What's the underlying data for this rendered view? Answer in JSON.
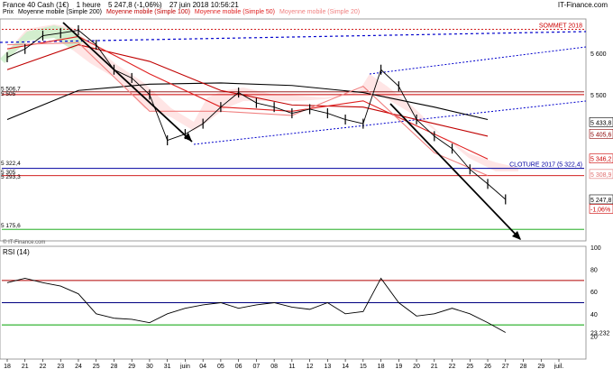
{
  "header": {
    "instrument": "France 40 Cash (1€)",
    "timeframe": "1 heure",
    "quote": "5 247,8 (-1,06%)",
    "datetime": "27 juin 2018 10:56:21",
    "brand": "IT-Finance.com",
    "copyright": "© IT-Finance.com"
  },
  "legend": [
    {
      "label": "Prix",
      "color": "#000000"
    },
    {
      "label": "Moyenne mobile (Simple 200)",
      "color": "#000000"
    },
    {
      "label": "Moyenne mobile (Simple 100)",
      "color": "#c00000"
    },
    {
      "label": "Moyenne mobile (Simple 50)",
      "color": "#e02020"
    },
    {
      "label": "Moyenne mobile (Simple 20)",
      "color": "#f08080"
    }
  ],
  "chart_data": [
    {
      "type": "line",
      "ylim": [
        5150,
        5680
      ],
      "x_ticks": [
        "18",
        "21",
        "22",
        "23",
        "24",
        "25",
        "28",
        "29",
        "30",
        "31",
        "juin",
        "04",
        "05",
        "06",
        "07",
        "08",
        "11",
        "12",
        "13",
        "14",
        "15",
        "18",
        "19",
        "20",
        "21",
        "22",
        "25",
        "26",
        "27",
        "28",
        "29",
        "juil."
      ],
      "y_ticks": [
        5600,
        5500,
        5433.8,
        5405.6,
        5346.2,
        5308.9
      ],
      "series": [
        {
          "name": "Prix",
          "color": "#000000",
          "x": [
            0,
            1,
            2,
            3,
            4,
            5,
            6,
            7,
            8,
            9,
            10,
            11,
            12,
            13,
            14,
            15,
            16,
            17,
            18,
            19,
            20,
            21,
            22,
            23,
            24,
            25,
            26,
            27,
            28
          ],
          "values": [
            5590,
            5610,
            5642,
            5648,
            5655,
            5620,
            5560,
            5540,
            5500,
            5390,
            5405,
            5430,
            5470,
            5505,
            5480,
            5470,
            5455,
            5465,
            5455,
            5440,
            5430,
            5560,
            5520,
            5440,
            5400,
            5370,
            5320,
            5285,
            5247.8
          ]
        },
        {
          "name": "Moyenne mobile (Simple 200)",
          "color": "#000000",
          "x": [
            0,
            4,
            8,
            12,
            16,
            20,
            24,
            27
          ],
          "values": [
            5440,
            5510,
            5525,
            5528,
            5522,
            5505,
            5470,
            5440
          ]
        },
        {
          "name": "Moyenne mobile (Simple 100)",
          "color": "#c00000",
          "x": [
            0,
            4,
            8,
            12,
            16,
            20,
            24,
            27
          ],
          "values": [
            5560,
            5620,
            5580,
            5510,
            5475,
            5470,
            5430,
            5400
          ]
        },
        {
          "name": "Moyenne mobile (Simple 50)",
          "color": "#e02020",
          "x": [
            0,
            4,
            8,
            12,
            16,
            20,
            24,
            27
          ],
          "values": [
            5610,
            5640,
            5550,
            5470,
            5460,
            5485,
            5405,
            5345
          ]
        },
        {
          "name": "Moyenne mobile (Simple 20)",
          "color": "#f08080",
          "x": [
            0,
            4,
            8,
            12,
            16,
            20,
            24,
            27
          ],
          "values": [
            5620,
            5625,
            5460,
            5460,
            5450,
            5520,
            5360,
            5305
          ]
        }
      ],
      "annotations": [
        {
          "label": "SOMMET 2018",
          "value": 5657,
          "color": "#cc0000",
          "style": "dotted"
        },
        {
          "label": "CLOTURE 2017 (5 322,4)",
          "value": 5322.4,
          "color": "#0000a0",
          "style": "solid"
        },
        {
          "label": "5 506,7",
          "value": 5506.7,
          "color": "#8b0000",
          "style": "solid"
        },
        {
          "label": "5 500",
          "value": 5500,
          "color": "#cc0000",
          "style": "solid"
        },
        {
          "label": "5 305",
          "value": 5305,
          "color": "#cc0000",
          "style": "solid"
        },
        {
          "label": "5 175,6",
          "value": 5175.6,
          "color": "#00a000",
          "style": "solid"
        }
      ],
      "price_badges": [
        {
          "label": "5 433,8",
          "value": 5433.8,
          "color": "#000000"
        },
        {
          "label": "5 405,6",
          "value": 5405.6,
          "color": "#8b0000"
        },
        {
          "label": "5 346,2",
          "value": 5346.2,
          "color": "#cc0000"
        },
        {
          "label": "5 308,9",
          "value": 5308.9,
          "color": "#e07070"
        },
        {
          "label": "5 247,8",
          "value": 5247.8,
          "color": "#000000"
        },
        {
          "label": "-1,06%",
          "value": 5225,
          "color": "#cc0000"
        }
      ],
      "left_labels": [
        {
          "label": "5 506,7",
          "value": 5510
        },
        {
          "label": "5 505",
          "value": 5497
        },
        {
          "label": "5 322,4",
          "value": 5330
        },
        {
          "label": "5 305",
          "value": 5309
        },
        {
          "label": "5 293,3",
          "value": 5298
        },
        {
          "label": "5 175,6",
          "value": 5180
        }
      ]
    },
    {
      "type": "line",
      "title": "RSI (14)",
      "ylim": [
        0,
        100
      ],
      "y_ticks": [
        100,
        80,
        60,
        40,
        20
      ],
      "levels": [
        {
          "value": 70,
          "color": "#b00000"
        },
        {
          "value": 50,
          "color": "#000080"
        },
        {
          "value": 30,
          "color": "#00a000"
        }
      ],
      "last_value_label": "23,232",
      "series": [
        {
          "name": "RSI (14)",
          "color": "#000000",
          "x": [
            0,
            1,
            2,
            3,
            4,
            5,
            6,
            7,
            8,
            9,
            10,
            11,
            12,
            13,
            14,
            15,
            16,
            17,
            18,
            19,
            20,
            21,
            22,
            23,
            24,
            25,
            26,
            27,
            28
          ],
          "values": [
            68,
            72,
            68,
            65,
            58,
            40,
            36,
            35,
            32,
            40,
            45,
            48,
            50,
            45,
            48,
            50,
            46,
            44,
            50,
            40,
            42,
            72,
            50,
            38,
            40,
            45,
            40,
            32,
            23.2
          ]
        }
      ]
    }
  ]
}
